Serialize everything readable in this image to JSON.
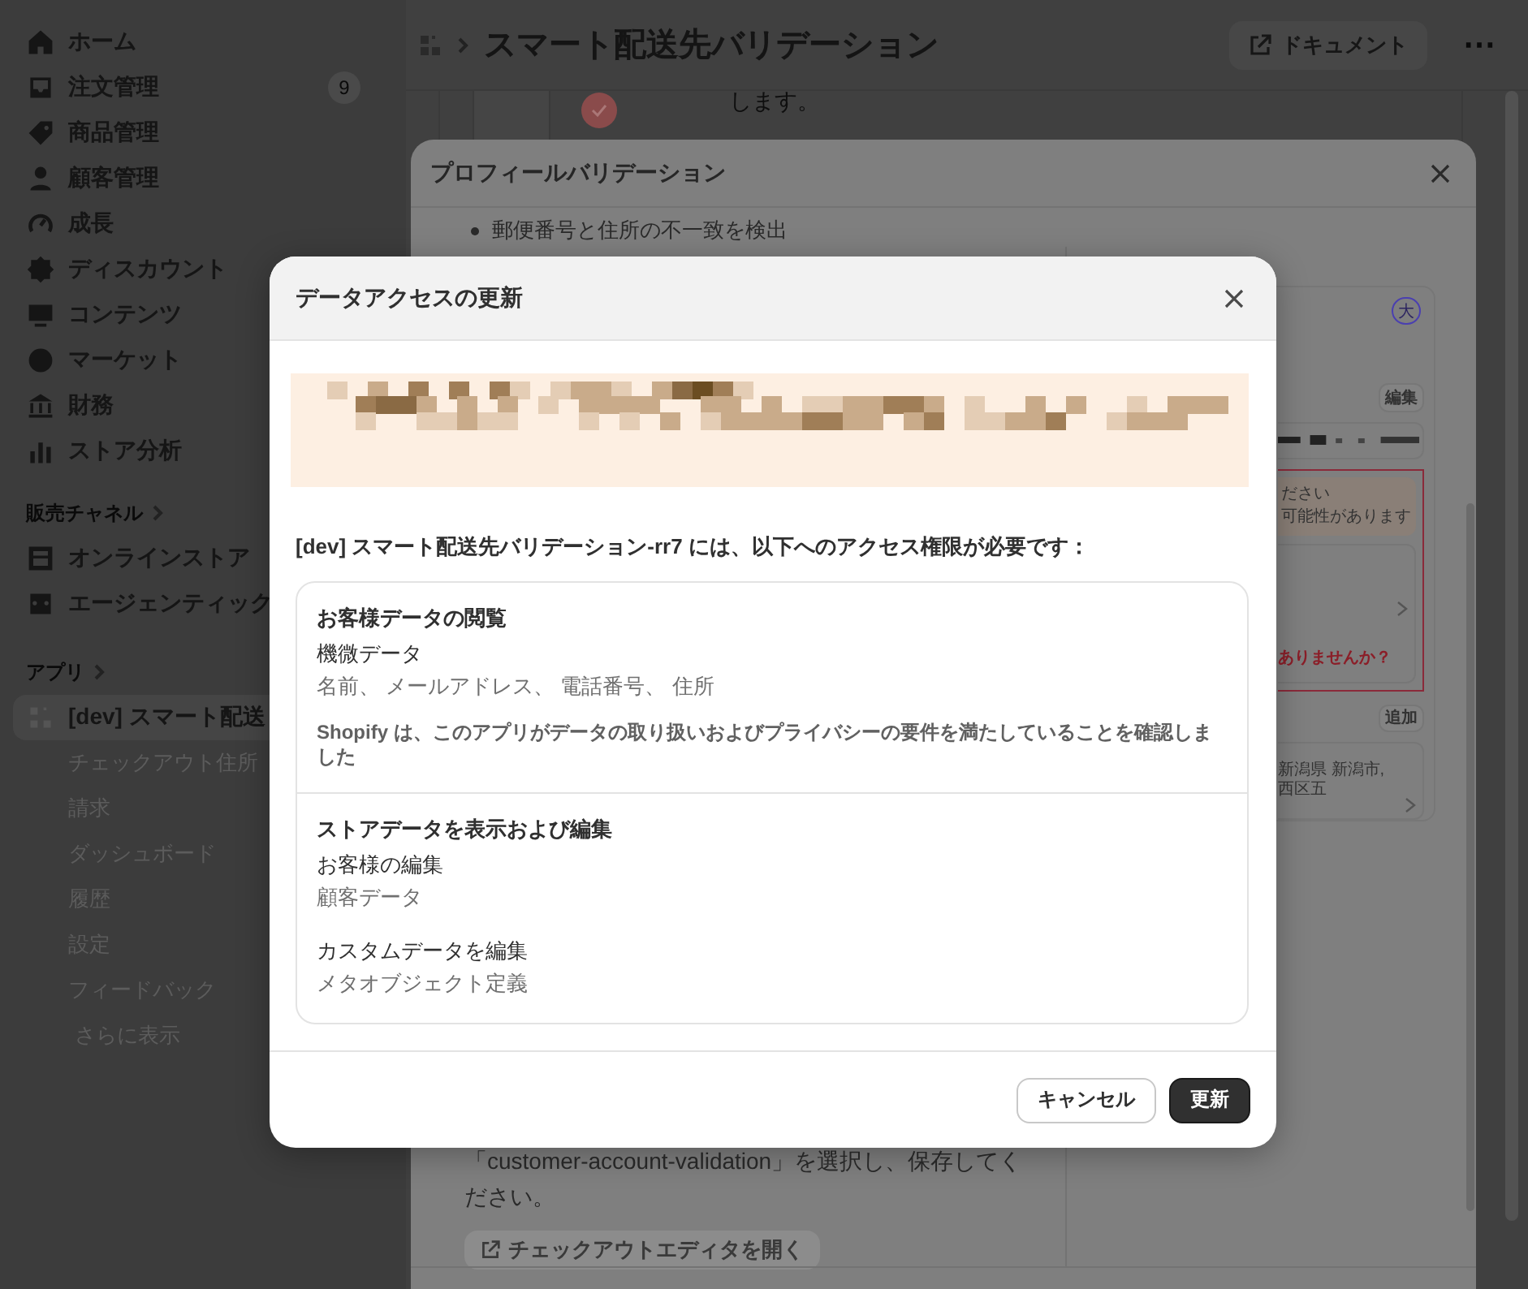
{
  "sidebar": {
    "main_items": [
      {
        "label": "ホーム",
        "selected": false
      },
      {
        "label": "注文管理",
        "selected": false,
        "badge": "9"
      },
      {
        "label": "商品管理",
        "selected": false
      },
      {
        "label": "顧客管理",
        "selected": false
      },
      {
        "label": "成長",
        "selected": false
      },
      {
        "label": "ディスカウント",
        "selected": false
      },
      {
        "label": "コンテンツ",
        "selected": false
      },
      {
        "label": "マーケット",
        "selected": false
      },
      {
        "label": "財務",
        "selected": false
      },
      {
        "label": "ストア分析",
        "selected": false
      }
    ],
    "channels_heading": "販売チャネル",
    "channels": [
      {
        "label": "オンラインストア",
        "selected": false
      },
      {
        "label": "エージェンティック",
        "selected": false
      }
    ],
    "apps_heading": "アプリ",
    "apps": [
      {
        "label": "[dev] スマート配送",
        "selected": true,
        "children": [
          {
            "label": "チェックアウト住所",
            "selected": false
          },
          {
            "label": "請求",
            "selected": false
          },
          {
            "label": "ダッシュボード",
            "selected": false
          },
          {
            "label": "履歴",
            "selected": false
          },
          {
            "label": "設定",
            "selected": false
          },
          {
            "label": "フィードバック",
            "selected": false
          }
        ]
      }
    ],
    "more_link": "さらに表示"
  },
  "top_bar": {
    "title": "スマート配送先バリデーション",
    "docs_button": "ドキュメント",
    "more_button": "⋯"
  },
  "background_card": {
    "text": "します。"
  },
  "profile_modal": {
    "title": "プロフィールバリデーション",
    "bullets": [
      "郵便番号と住所の不一致を検出"
    ],
    "instructions": "「customer-account-validation」を選択し、保存してください。",
    "editor_button": "チェックアウトエディタを開く",
    "preview": {
      "avatar_initial": "大",
      "edit_button": "編集",
      "warning_title": "ださい",
      "warning_text": "可能性があります",
      "error_link": "ありませんか？",
      "add_button": "追加",
      "address": "新潟県 新潟市, 西区五"
    }
  },
  "access_dialog": {
    "title": "データアクセスの更新",
    "intro": "[dev] スマート配送先バリデーション-rr7 には、以下へのアクセス権限が必要です：",
    "sections": [
      {
        "title": "お客様データの閲覧",
        "groups": [
          {
            "name": "機微データ",
            "detail": "名前、 メールアドレス、 電話番号、 住所"
          }
        ],
        "note": "Shopify は、このアプリがデータの取り扱いおよびプライバシーの要件を満たしていることを確認しました"
      },
      {
        "title": "ストアデータを表示および編集",
        "groups": [
          {
            "name": "お客様の編集",
            "detail": "顧客データ"
          },
          {
            "name": "カスタムデータを編集",
            "detail": "メタオブジェクト定義"
          }
        ]
      }
    ],
    "buttons": [
      {
        "label": "キャンセル",
        "kind": "secondary"
      },
      {
        "label": "更新",
        "kind": "primary"
      }
    ]
  }
}
